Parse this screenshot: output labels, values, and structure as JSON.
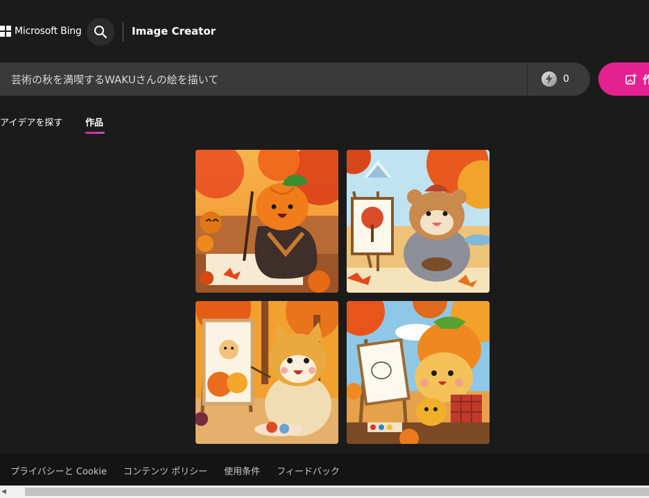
{
  "header": {
    "brand": "Microsoft Bing",
    "app_title": "Image Creator",
    "search_icon": "search-icon"
  },
  "prompt": {
    "value": "芸術の秋を満喫するWAKUさんの絵を描いて",
    "boost_count": "0",
    "create_label": "作成"
  },
  "tabs": [
    {
      "label": "アイデアを探す",
      "active": false
    },
    {
      "label": "作品",
      "active": true
    }
  ],
  "accent_color": "#e5218f",
  "footer": {
    "links": [
      "プライバシーと Cookie",
      "コンテンツ ポリシー",
      "使用条件",
      "フィードバック"
    ]
  }
}
